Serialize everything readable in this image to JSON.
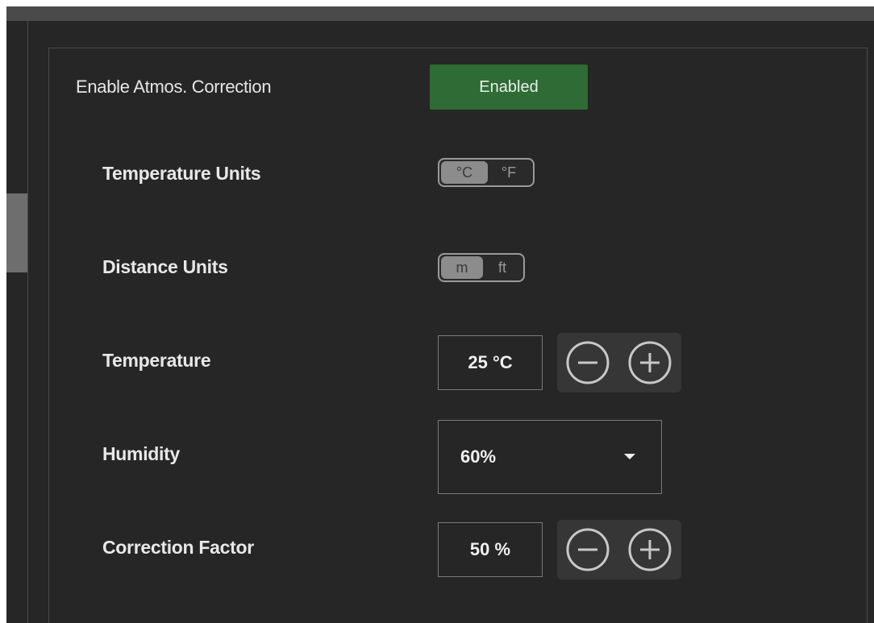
{
  "settings": {
    "enable_atmos_correction": {
      "label": "Enable Atmos. Correction",
      "button_label": "Enabled",
      "button_color": "#2e6b35"
    },
    "temperature_units": {
      "label": "Temperature Units",
      "options": [
        "°C",
        "°F"
      ],
      "selected": "°C"
    },
    "distance_units": {
      "label": "Distance Units",
      "options": [
        "m",
        "ft"
      ],
      "selected": "m"
    },
    "temperature": {
      "label": "Temperature",
      "value": "25 °C",
      "decrement_icon": "minus-circle-icon",
      "increment_icon": "plus-circle-icon"
    },
    "humidity": {
      "label": "Humidity",
      "value": "60%",
      "dropdown_icon": "caret-down-icon"
    },
    "correction_factor": {
      "label": "Correction Factor",
      "value": "50 %",
      "decrement_icon": "minus-circle-icon",
      "increment_icon": "plus-circle-icon"
    }
  },
  "colors": {
    "background": "#262626",
    "panel_border": "#4a4a4a",
    "text": "#e8e8e8",
    "accent_green": "#2e6b35"
  }
}
